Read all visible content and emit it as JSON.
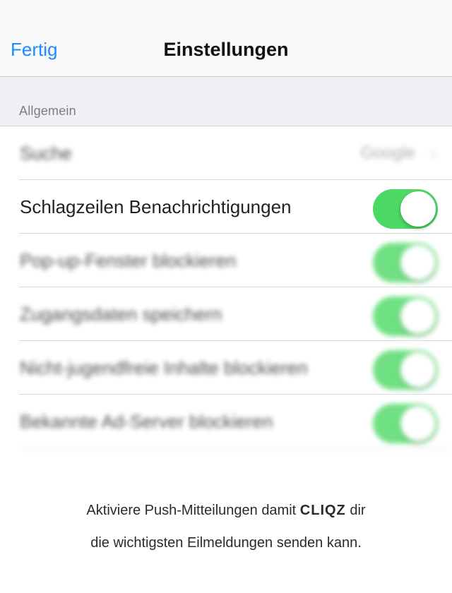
{
  "navbar": {
    "done_label": "Fertig",
    "title": "Einstellungen"
  },
  "section": {
    "header": "Allgemein"
  },
  "rows": [
    {
      "label": "Suche",
      "value": "Google",
      "type": "disclosure"
    },
    {
      "label": "Schlagzeilen Benachrichtigungen",
      "type": "toggle",
      "on": true
    },
    {
      "label": "Pop-up-Fenster blockieren",
      "type": "toggle",
      "on": true
    },
    {
      "label": "Zugangsdaten speichern",
      "type": "toggle",
      "on": true
    },
    {
      "label": "Nicht-jugendfreie Inhalte blockieren",
      "type": "toggle",
      "on": true
    },
    {
      "label": "Bekannte Ad-Server blockieren",
      "type": "toggle",
      "on": true
    }
  ],
  "footer": {
    "line1_prefix": "Aktiviere Push-Mitteilungen damit ",
    "brand": "CLIQZ",
    "line1_suffix": " dir",
    "line2": "die wichtigsten Eilmeldungen senden kann."
  },
  "colors": {
    "accent": "#1a8cff",
    "toggle_on": "#4cd964"
  }
}
